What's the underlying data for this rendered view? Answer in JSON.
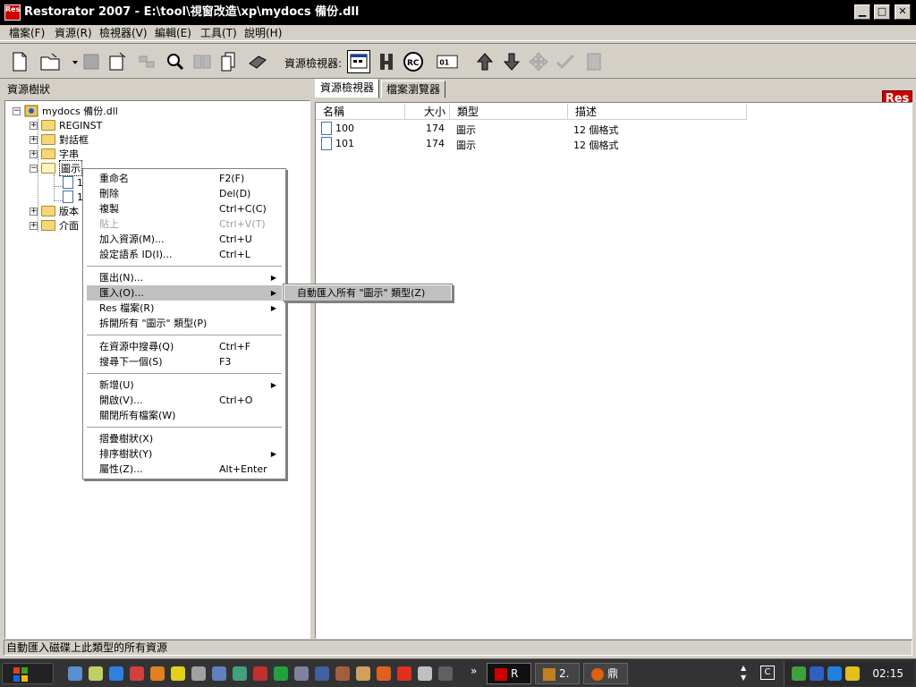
{
  "window": {
    "icon_text": "Res",
    "title": "Restorator 2007 - E:\\tool\\視窗改造\\xp\\mydocs 備份.dll",
    "min_label": "▁",
    "max_label": "□",
    "close_label": "✕"
  },
  "menubar": [
    {
      "label": "檔案(F)"
    },
    {
      "label": "資源(R)"
    },
    {
      "label": "檢視器(V)"
    },
    {
      "label": "編輯(E)"
    },
    {
      "label": "工具(T)"
    },
    {
      "label": "說明(H)"
    }
  ],
  "toolbar": {
    "viewer_label": "資源檢視器:",
    "logo_text": "Res"
  },
  "tree": {
    "header": "資源樹狀",
    "root": "mydocs 備份.dll",
    "nodes": [
      {
        "label": "REGINST",
        "expander": "+"
      },
      {
        "label": "對話框",
        "expander": "+"
      },
      {
        "label": "字串",
        "expander": "+"
      },
      {
        "label": "圖示",
        "expander": "−"
      },
      {
        "label": "1"
      },
      {
        "label": "1"
      },
      {
        "label": "版本",
        "expander": "+"
      },
      {
        "label": "介面",
        "expander": "+"
      }
    ]
  },
  "tabs": [
    {
      "label": "資源檢視器"
    },
    {
      "label": "檔案瀏覽器"
    }
  ],
  "list": {
    "columns": [
      "名稱",
      "大小",
      "類型",
      "描述"
    ],
    "rows": [
      {
        "name": "100",
        "size": "174",
        "type": "圖示",
        "desc": "12 個格式"
      },
      {
        "name": "101",
        "size": "174",
        "type": "圖示",
        "desc": "12 個格式"
      }
    ]
  },
  "context_menu": {
    "items": [
      {
        "label": "重命名",
        "shortcut": "F2(F)"
      },
      {
        "label": "刪除",
        "shortcut": "Del(D)"
      },
      {
        "label": "複製",
        "shortcut": "Ctrl+C(C)"
      },
      {
        "label": "貼上",
        "shortcut": "Ctrl+V(T)"
      },
      {
        "label": "加入資源(M)...",
        "shortcut": "Ctrl+U"
      },
      {
        "label": "設定語系 ID(I)...",
        "shortcut": "Ctrl+L"
      },
      {
        "label": "匯出(N)...",
        "shortcut": ""
      },
      {
        "label": "匯入(O)...",
        "shortcut": ""
      },
      {
        "label": "Res 檔案(R)",
        "shortcut": ""
      },
      {
        "label": "拆開所有 \"圖示\" 類型(P)",
        "shortcut": ""
      },
      {
        "label": "在資源中搜尋(Q)",
        "shortcut": "Ctrl+F"
      },
      {
        "label": "搜尋下一個(S)",
        "shortcut": "F3"
      },
      {
        "label": "新增(U)",
        "shortcut": ""
      },
      {
        "label": "開啟(V)...",
        "shortcut": "Ctrl+O"
      },
      {
        "label": "關閉所有檔案(W)",
        "shortcut": ""
      },
      {
        "label": "摺疊樹狀(X)",
        "shortcut": ""
      },
      {
        "label": "排序樹狀(Y)",
        "shortcut": ""
      },
      {
        "label": "屬性(Z)...",
        "shortcut": "Alt+Enter"
      }
    ],
    "submenu_arrow": "▶"
  },
  "submenu": {
    "item": "自動匯入所有 \"圖示\" 類型(Z)"
  },
  "status_bar": {
    "text": "自動匯入磁碟上此類型的所有資源"
  },
  "taskbar": {
    "chevron": "»",
    "tasks": [
      {
        "label": "R"
      },
      {
        "label": "2."
      },
      {
        "label": "鼎"
      }
    ],
    "clock": "02:15"
  },
  "colors": {
    "title_bg": "#000000",
    "menu_hover": "#c0c0c0",
    "logo_red": "#cc0000"
  }
}
